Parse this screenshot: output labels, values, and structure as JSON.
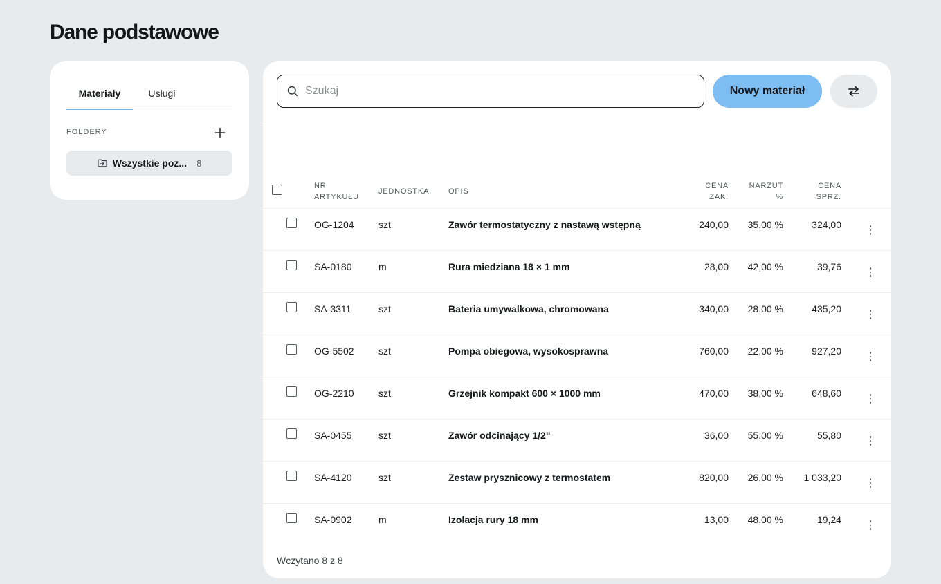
{
  "page": {
    "title": "Dane podstawowe"
  },
  "sidebar": {
    "tabs": [
      {
        "label": "Materiały",
        "active": true
      },
      {
        "label": "Usługi",
        "active": false
      }
    ],
    "folders_label": "FOLDERY",
    "folder": {
      "name": "Wszystkie poz...",
      "count": "8",
      "icon": "folder-icon"
    }
  },
  "toolbar": {
    "search_placeholder": "Szukaj",
    "search_value": "",
    "new_button_label": "Nowy materiał",
    "swap_icon": "arrows-swap-icon"
  },
  "colors": {
    "accent": "#7dbdf2",
    "tab_underline": "#6fb3ea",
    "background": "#e8ebee"
  },
  "table": {
    "headers": {
      "article_line1": "NR",
      "article_line2": "ARTYKUŁU",
      "unit": "JEDNOSTKA",
      "desc": "OPIS",
      "buy_line1": "CENA",
      "buy_line2": "ZAK.",
      "markup_line1": "NARZUT",
      "markup_line2": "%",
      "sell_line1": "CENA",
      "sell_line2": "SPRZ."
    },
    "rows": [
      {
        "article": "OG-1204",
        "unit": "szt",
        "desc": "Zawór termostatyczny z nastawą wstępną",
        "buy": "240,00",
        "markup": "35,00 %",
        "sell": "324,00"
      },
      {
        "article": "SA-0180",
        "unit": "m",
        "desc": "Rura miedziana 18 × 1 mm",
        "buy": "28,00",
        "markup": "42,00 %",
        "sell": "39,76"
      },
      {
        "article": "SA-3311",
        "unit": "szt",
        "desc": "Bateria umywalkowa, chromowana",
        "buy": "340,00",
        "markup": "28,00 %",
        "sell": "435,20"
      },
      {
        "article": "OG-5502",
        "unit": "szt",
        "desc": "Pompa obiegowa, wysokosprawna",
        "buy": "760,00",
        "markup": "22,00 %",
        "sell": "927,20"
      },
      {
        "article": "OG-2210",
        "unit": "szt",
        "desc": "Grzejnik kompakt 600 × 1000 mm",
        "buy": "470,00",
        "markup": "38,00 %",
        "sell": "648,60"
      },
      {
        "article": "SA-0455",
        "unit": "szt",
        "desc": "Zawór odcinający 1/2\"",
        "buy": "36,00",
        "markup": "55,00 %",
        "sell": "55,80"
      },
      {
        "article": "SA-4120",
        "unit": "szt",
        "desc": "Zestaw prysznicowy z termostatem",
        "buy": "820,00",
        "markup": "26,00 %",
        "sell": "1 033,20"
      },
      {
        "article": "SA-0902",
        "unit": "m",
        "desc": "Izolacja rury 18 mm",
        "buy": "13,00",
        "markup": "48,00 %",
        "sell": "19,24"
      }
    ],
    "footer": "Wczytano 8 z 8"
  }
}
